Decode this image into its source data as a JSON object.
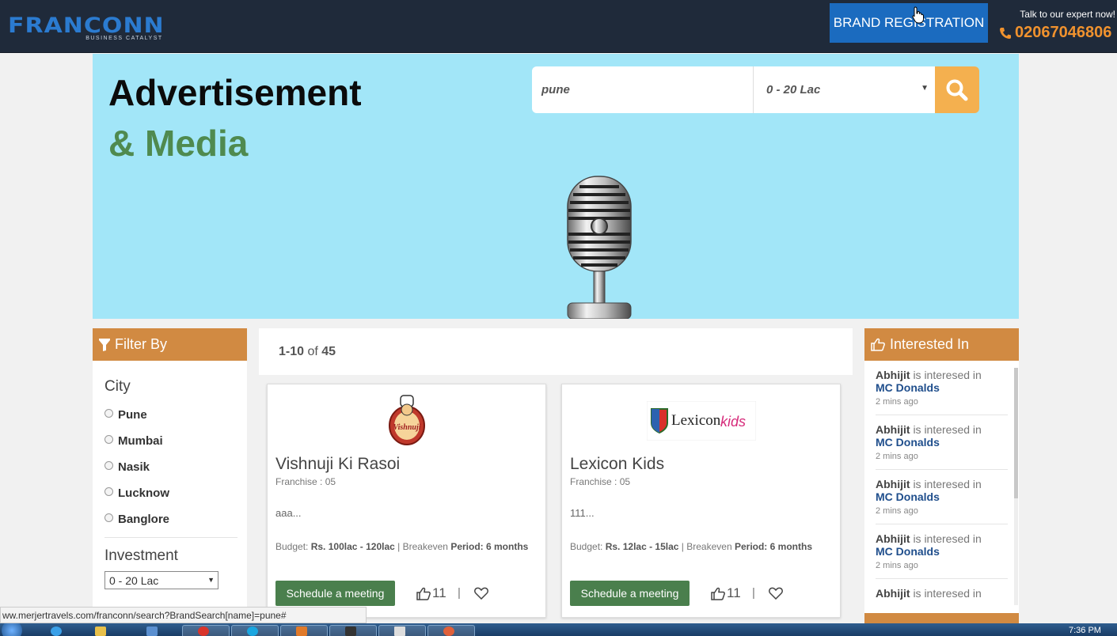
{
  "header": {
    "logo_text": "FRANCONN",
    "logo_tagline": "BUSINESS CATALYST",
    "brand_registration_label": "BRAND REGISTRATION",
    "talk_text": "Talk to our expert now!",
    "phone": "02067046806"
  },
  "hero": {
    "title_line1": "Advertisement",
    "title_line2": "& Media",
    "search_value": "pune",
    "budget_value": "0 - 20 Lac"
  },
  "filter": {
    "heading": "Filter By",
    "city_title": "City",
    "cities": [
      "Pune",
      "Mumbai",
      "Nasik",
      "Lucknow",
      "Banglore"
    ],
    "investment_title": "Investment",
    "investment_value": "0 - 20 Lac"
  },
  "results": {
    "range": "1-10",
    "of_text": "of",
    "total": "45"
  },
  "cards": [
    {
      "name": "Vishnuji Ki Rasoi",
      "franchise": "Franchise : 05",
      "description": "aaa...",
      "budget_label": "Budget:",
      "budget_value": "Rs. 100lac - 120lac",
      "breakeven_label": "| Breakeven",
      "period_label": "Period:",
      "period_value": "6 months",
      "meeting_label": "Schedule a meeting",
      "likes": "11",
      "logo_text": "Vishnuji"
    },
    {
      "name": "Lexicon Kids",
      "franchise": "Franchise : 05",
      "description": "111...",
      "budget_label": "Budget:",
      "budget_value": "Rs. 12lac - 15lac",
      "breakeven_label": "| Breakeven",
      "period_label": "Period:",
      "period_value": "6 months",
      "meeting_label": "Schedule a meeting",
      "likes": "11",
      "logo_text": "Lexicon",
      "logo_text2": "kids"
    }
  ],
  "interested": {
    "heading": "Interested In",
    "items": [
      {
        "name": "Abhijit",
        "text": "is interesed in",
        "brand": "MC Donalds",
        "time": "2 mins ago"
      },
      {
        "name": "Abhijit",
        "text": "is interesed in",
        "brand": "MC Donalds",
        "time": "2 mins ago"
      },
      {
        "name": "Abhijit",
        "text": "is interesed in",
        "brand": "MC Donalds",
        "time": "2 mins ago"
      },
      {
        "name": "Abhijit",
        "text": "is interesed in",
        "brand": "MC Donalds",
        "time": "2 mins ago"
      },
      {
        "name": "Abhijit",
        "text": "is interesed in",
        "brand": "",
        "time": ""
      }
    ]
  },
  "statusbar": {
    "url": "ww.merjertravels.com/franconn/search?BrandSearch[name]=pune#"
  },
  "taskbar": {
    "clock": "7:36 PM"
  },
  "colors": {
    "header_bg": "#1f2a3a",
    "brand_blue": "#1b6bbf",
    "phone_orange": "#f0922e",
    "hero_bg": "#a2e6f8",
    "accent_green": "#4f8a4f",
    "panel_orange": "#d18a42",
    "search_btn": "#f4b04f",
    "brand_link": "#1f4e8c"
  }
}
